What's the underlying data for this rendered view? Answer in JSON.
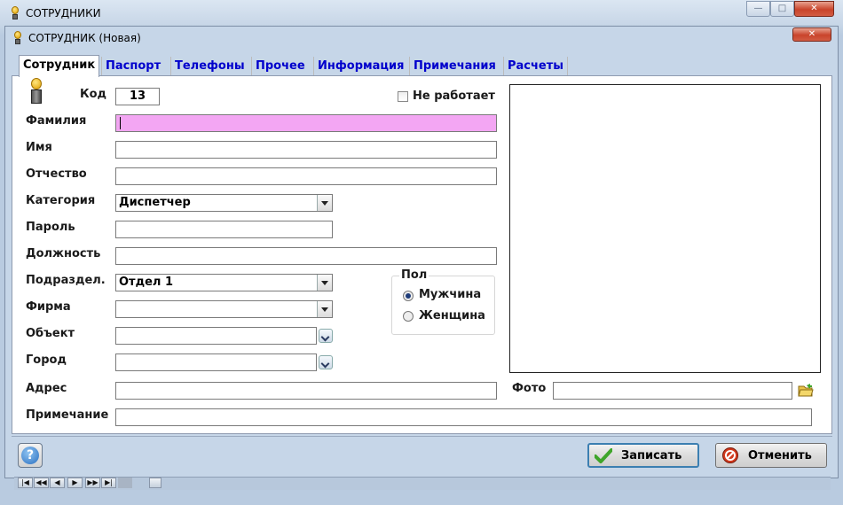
{
  "outer_window": {
    "title": "СОТРУДНИКИ",
    "controls": {
      "minimize": "—",
      "maximize": "□",
      "close": "✕"
    }
  },
  "inner_window": {
    "title": "СОТРУДНИК  (Новая)",
    "close": "✕"
  },
  "tabs": [
    "Сотрудник",
    "Паспорт",
    "Телефоны",
    "Прочее",
    "Информация",
    "Примечания",
    "Расчеты"
  ],
  "form": {
    "code_label": "Код",
    "code_value": "13",
    "not_working_label": "Не работает",
    "surname_label": "Фамилия",
    "surname_value": "",
    "name_label": "Имя",
    "name_value": "",
    "patronymic_label": "Отчество",
    "patronymic_value": "",
    "category_label": "Категория",
    "category_value": "Диспетчер",
    "password_label": "Пароль",
    "password_value": "",
    "position_label": "Должность",
    "position_value": "",
    "department_label": "Подраздел.",
    "department_value": "Отдел 1",
    "firm_label": "Фирма",
    "firm_value": "",
    "object_label": "Объект",
    "object_value": "",
    "city_label": "Город",
    "city_value": "",
    "address_label": "Адрес",
    "address_value": "",
    "note_label": "Примечание",
    "note_value": "",
    "photo_label": "Фото",
    "photo_value": ""
  },
  "gender": {
    "title": "Пол",
    "male": "Мужчина",
    "female": "Женщина",
    "selected": "Мужчина"
  },
  "buttons": {
    "help": "?",
    "save": "Записать",
    "cancel": "Отменить"
  },
  "navigator": [
    "|◀",
    "◀◀",
    "◀",
    "▶",
    "▶▶",
    "▶|"
  ],
  "colors": {
    "surname_highlight": "#f3a6f3",
    "tab_link": "#0000cc",
    "save_icon": "#3fa52a",
    "cancel_icon": "#d23a1e"
  }
}
